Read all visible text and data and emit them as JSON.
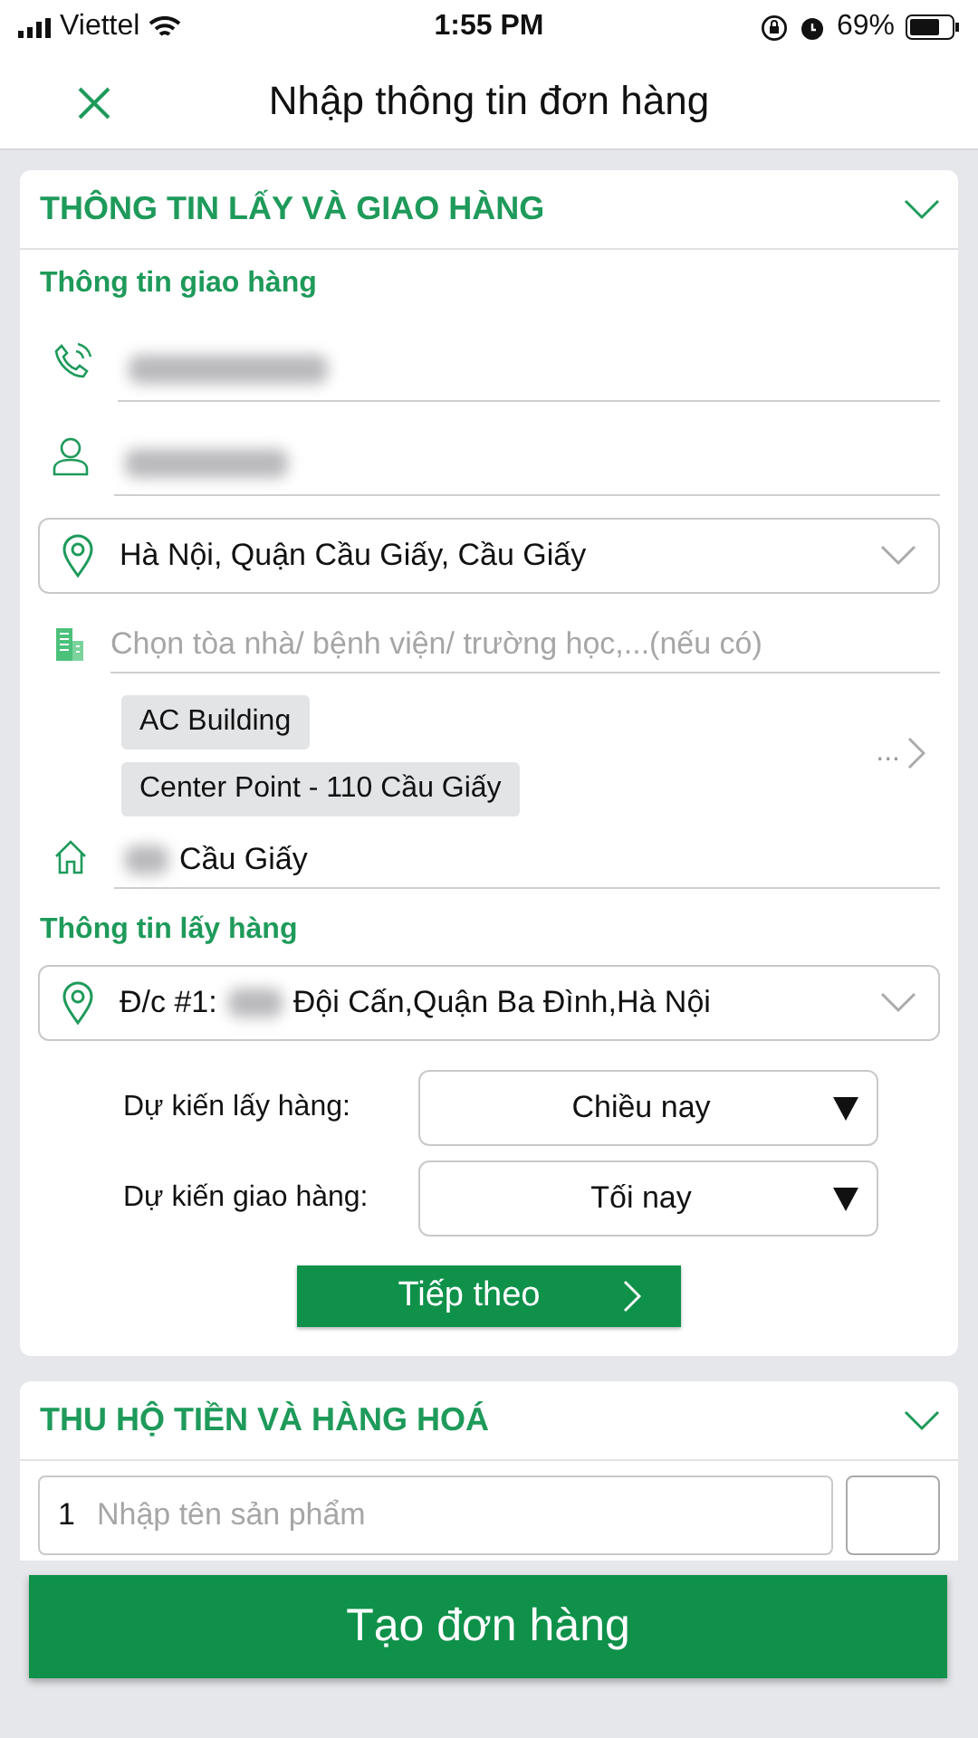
{
  "status_bar": {
    "carrier": "Viettel",
    "time": "1:55 PM",
    "battery": "69%"
  },
  "header": {
    "title": "Nhập thông tin đơn hàng"
  },
  "pickup_delivery": {
    "title": "THÔNG TIN LẤY VÀ GIAO HÀNG",
    "delivery": {
      "heading": "Thông tin giao hàng",
      "fields": [
        {
          "kind": "phone"
        },
        {
          "kind": "name"
        }
      ],
      "area": "Hà Nội, Quận Cầu Giấy, Cầu Giấy",
      "building": {
        "placeholder": "Chọn tòa nhà/ bệnh viện/ trường học,...(nếu có)",
        "suggestions": [
          "AC Building",
          "Center Point - 110 Cầu Giấy"
        ],
        "more": "..."
      },
      "street": "Cầu Giấy"
    },
    "pickup": {
      "heading": "Thông tin lấy hàng",
      "address_label": "Đ/c #1:",
      "address": "Đội Cấn,Quận Ba Đình,Hà Nội",
      "schedule": [
        {
          "label": "Dự kiến lấy hàng:",
          "value": "Chiều nay"
        },
        {
          "label": "Dự kiến giao hàng:",
          "value": "Tối nay"
        }
      ]
    },
    "next_button": "Tiếp theo"
  },
  "goods": {
    "title": "THU HỘ TIỀN VÀ HÀNG HOÁ",
    "item_number": "1",
    "item_placeholder": "Nhập tên sản phẩm"
  },
  "create_button": "Tạo đơn hàng"
}
